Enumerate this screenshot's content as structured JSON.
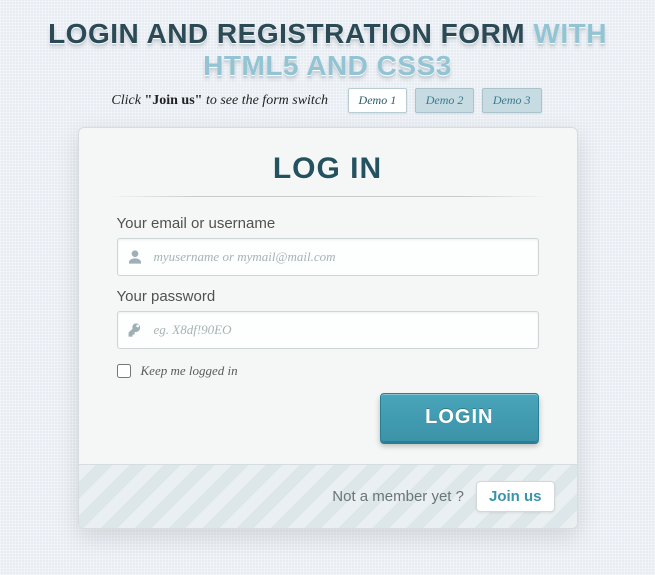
{
  "header": {
    "title_dark": "Login and Registration Form ",
    "title_light": "with HTML5 and CSS3",
    "hint_prefix": "Click ",
    "hint_bold": "\"Join us\"",
    "hint_suffix": " to see the form switch",
    "demos": [
      "Demo 1",
      "Demo 2",
      "Demo 3"
    ]
  },
  "card": {
    "title": "Log in",
    "email_label": "Your email or username",
    "email_placeholder": "myusername or mymail@mail.com",
    "password_label": "Your password",
    "password_placeholder": "eg. X8df!90EO",
    "remember_label": "Keep me logged in",
    "submit_label": "Login"
  },
  "footer": {
    "text": "Not a member yet ?",
    "join_label": "Join us"
  }
}
